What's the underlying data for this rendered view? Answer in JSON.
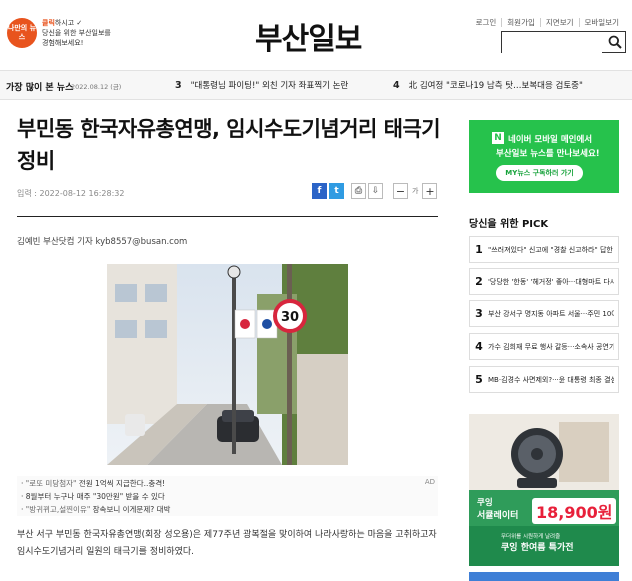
{
  "header": {
    "promo_badge": "나만의 뉴스",
    "promo_line1_pre": "클릭",
    "promo_line1_post": "하시고 ✓",
    "promo_line2": "당신을 위한 부산일보를",
    "promo_line3": "경험해보세요!",
    "logo": "부산일보",
    "top_links": [
      "로그인",
      "회원가입",
      "지면보기",
      "모바일보기"
    ],
    "search_placeholder": ""
  },
  "popular": {
    "title": "가장 많이 본 뉴스",
    "date": "2022.08.12 (금)",
    "items": [
      {
        "num": "3",
        "text": "\"대통령님 파이팅!\" 외친 기자 좌표찍기 논란"
      },
      {
        "num": "4",
        "text": "北 김여정 \"코로나19 남측 탓…보복대응 검토중\""
      }
    ]
  },
  "article": {
    "title": "부민동 한국자유총연맹, 임시수도기념거리 태극기 정비",
    "date": "입력 : 2022-08-12 16:28:32",
    "font_label": "가",
    "byline": "김예빈 부산닷컴 기자 kyb8557@busan.com",
    "body": "부산 서구 부민동 한국자유총연맹(회장 성오용)은 제77주년 광복절을 맞이하여 나라사랑하는 마음을 고취하고자 임시수도기념거리 일원의 태극기를 정비하였다."
  },
  "share": {
    "facebook": "f",
    "twitter": "t",
    "print": "⎙",
    "download": "⇩",
    "font_minus": "−",
    "font_plus": "+"
  },
  "ad_links": {
    "tag": "AD",
    "items": [
      {
        "pre": "· ",
        "quote": "\"로또 미당첨자\"",
        "post": " 전원 1억씩 지급한다..충격!"
      },
      {
        "pre": "· ",
        "quote": "",
        "post": "8월부터 누구나 매주 \"30만원\" 받을 수 있다"
      },
      {
        "pre": "· ",
        "quote": "\"방귀뀌고,설찐이유\"",
        "post": " 장속보니 이게문제? 대박"
      }
    ]
  },
  "sidebar": {
    "naver": {
      "n": "N",
      "line1": "네이버 모바일 메인에서",
      "line2": "부산일보 뉴스를 만나보세요!",
      "button": "MY뉴스 구독하러 가기"
    },
    "pick_title": "당신을 위한 PICK",
    "picks": [
      {
        "num": "1",
        "text": "\"쓰러져있다\" 신고에 \"경찰 신고하라\" 답한 소…"
      },
      {
        "num": "2",
        "text": "'당당한 '한동' '헤거정' 좋아···대형마트 다시'…"
      },
      {
        "num": "3",
        "text": "부산 강서구 명지동 아파트 서울···주민 10여 명…"
      },
      {
        "num": "4",
        "text": "가수 김희재 무료 행사 갈등···소속사 공연기획…"
      },
      {
        "num": "5",
        "text": "MB·김경수 사면제외?···윤 대통령 최종 결심은"
      }
    ],
    "ad": {
      "label1": "쿠잉",
      "label2": "서큘레이터",
      "price": "18,900원",
      "sub": "무더위를 시원하게 날려줄",
      "cta": "쿠잉 한여름 특가전"
    }
  },
  "colors": {
    "accent_orange": "#e8541e",
    "naver_green": "#26c24c",
    "facebook_blue": "#2b64c7",
    "twitter_blue": "#2f9be2"
  }
}
